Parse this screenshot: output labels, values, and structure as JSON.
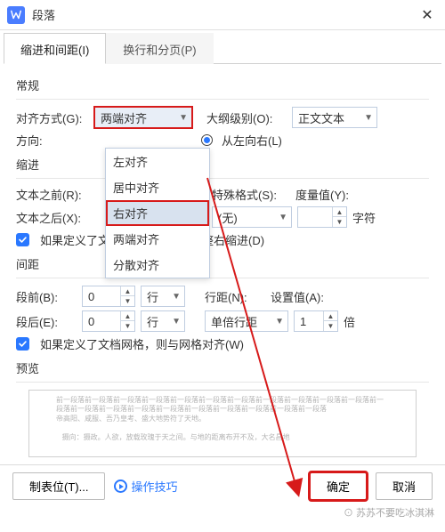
{
  "window": {
    "title": "段落"
  },
  "tabs": {
    "indent": "缩进和间距(I)",
    "paging": "换行和分页(P)"
  },
  "general": {
    "header": "常规",
    "align_lab": "对齐方式(G):",
    "align_val": "两端对齐",
    "outline_lab": "大纲级别(O):",
    "outline_val": "正文文本",
    "dir_lab": "方向:",
    "dir_opt": "从左向右(L)"
  },
  "align_options": [
    "左对齐",
    "居中对齐",
    "右对齐",
    "两端对齐",
    "分散对齐"
  ],
  "indent": {
    "header": "缩进",
    "before_lab": "文本之前(R):",
    "after_lab": "文本之后(X):",
    "special_lab": "特殊格式(S):",
    "metric_lab": "度量值(Y):",
    "special_val": "(无)",
    "unit": "字符",
    "chk": "如果定义了文档网格，则自动调整右缩进(D)"
  },
  "spacing": {
    "header": "间距",
    "before_lab": "段前(B):",
    "after_lab": "段后(E):",
    "before_val": "0",
    "after_val": "0",
    "line_unit": "行",
    "linesp_lab": "行距(N):",
    "linesp_val": "单倍行距",
    "setval_lab": "设置值(A):",
    "setval_val": "1",
    "setval_unit": "倍",
    "chk": "如果定义了文档网格，则与网格对齐(W)"
  },
  "preview": {
    "header": "预览"
  },
  "buttons": {
    "tabstops": "制表位(T)...",
    "tips": "操作技巧",
    "ok": "确定",
    "cancel": "取消"
  },
  "watermark": "⊙ 苏苏不要吃冰淇淋"
}
